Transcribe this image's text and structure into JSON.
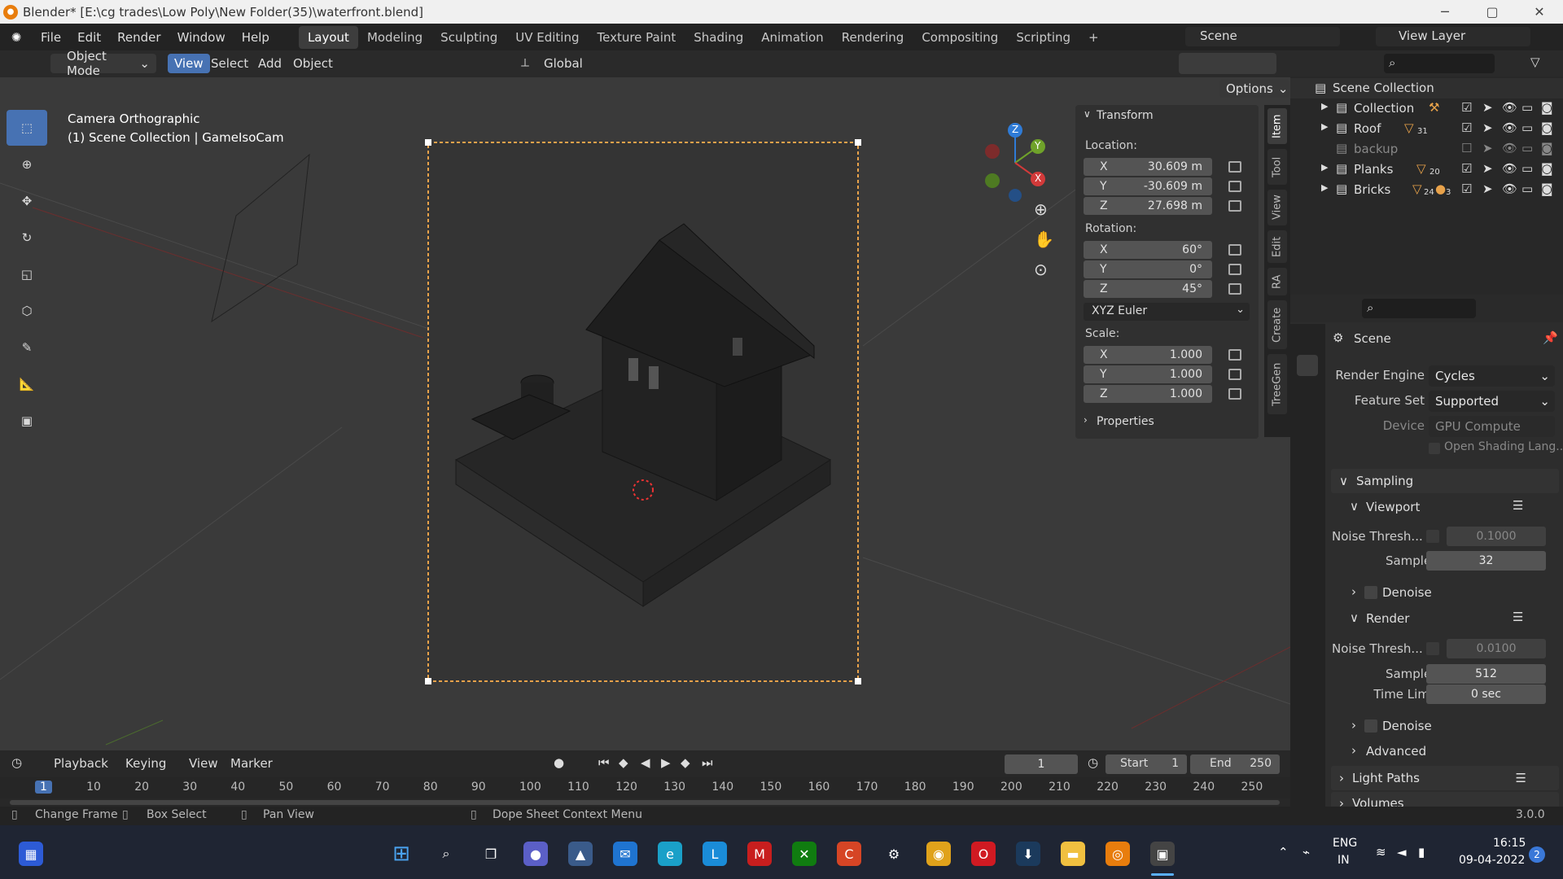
{
  "title_bar": {
    "text": "Blender* [E:\\cg trades\\Low Poly\\New Folder(35)\\waterfront.blend]",
    "min": "─",
    "max": "▢",
    "close": "✕"
  },
  "menu": [
    "File",
    "Edit",
    "Render",
    "Window",
    "Help"
  ],
  "workspaces": [
    "Layout",
    "Modeling",
    "Sculpting",
    "UV Editing",
    "Texture Paint",
    "Shading",
    "Animation",
    "Rendering",
    "Compositing",
    "Scripting",
    "+"
  ],
  "active_workspace": "Layout",
  "scene_field": "Scene",
  "view_layer_field": "View Layer",
  "viewport_header": {
    "mode": "Object Mode",
    "menus": [
      "View",
      "Select",
      "Add",
      "Object"
    ],
    "orientation": "Global",
    "options": "Options"
  },
  "viewport": {
    "info_line1": "Camera Orthographic",
    "info_line2": "(1) Scene Collection | GameIsoCam",
    "gizmo": {
      "x": "X",
      "y": "Y",
      "z": "Z"
    }
  },
  "transform_panel": {
    "title": "Transform",
    "location_label": "Location:",
    "location": [
      {
        "axis": "X",
        "value": "30.609 m"
      },
      {
        "axis": "Y",
        "value": "-30.609 m"
      },
      {
        "axis": "Z",
        "value": "27.698 m"
      }
    ],
    "rotation_label": "Rotation:",
    "rotation": [
      {
        "axis": "X",
        "value": "60°"
      },
      {
        "axis": "Y",
        "value": "0°"
      },
      {
        "axis": "Z",
        "value": "45°"
      }
    ],
    "rotation_mode": "XYZ Euler",
    "scale_label": "Scale:",
    "scale": [
      {
        "axis": "X",
        "value": "1.000"
      },
      {
        "axis": "Y",
        "value": "1.000"
      },
      {
        "axis": "Z",
        "value": "1.000"
      }
    ],
    "properties_label": "Properties"
  },
  "sidebar_tabs": [
    "Item",
    "Tool",
    "View",
    "Edit",
    "RA",
    "Create",
    "TreeGen"
  ],
  "outliner": {
    "root": "Scene Collection",
    "items": [
      {
        "name": "Collection",
        "badge": ""
      },
      {
        "name": "Roof",
        "badge": "31"
      },
      {
        "name": "backup",
        "badge": ""
      },
      {
        "name": "Planks",
        "badge": "20"
      },
      {
        "name": "Bricks",
        "badge": "24",
        "badge2": "3"
      }
    ]
  },
  "properties": {
    "scene_title": "Scene",
    "render_engine_label": "Render Engine",
    "render_engine": "Cycles",
    "feature_set_label": "Feature Set",
    "feature_set": "Supported",
    "device_label": "Device",
    "device": "GPU Compute",
    "osl_label": "Open Shading Lang...",
    "sampling": "Sampling",
    "viewport_sub": "Viewport",
    "noise_thresh_label": "Noise Thresh...",
    "viewport_noise": "0.1000",
    "samples_label": "Samples",
    "viewport_samples": "32",
    "denoise": "Denoise",
    "render_sub": "Render",
    "render_noise": "0.0100",
    "render_samples": "512",
    "time_limit_label": "Time Limit",
    "time_limit": "0 sec",
    "advanced": "Advanced",
    "light_paths": "Light Paths",
    "volumes": "Volumes"
  },
  "timeline": {
    "menus": [
      "Playback",
      "Keying",
      "View",
      "Marker"
    ],
    "current_frame": "1",
    "start_label": "Start",
    "start": "1",
    "end_label": "End",
    "end": "250",
    "ruler": [
      "1",
      "10",
      "20",
      "30",
      "40",
      "50",
      "60",
      "70",
      "80",
      "90",
      "100",
      "110",
      "120",
      "130",
      "140",
      "150",
      "160",
      "170",
      "180",
      "190",
      "200",
      "210",
      "220",
      "230",
      "240",
      "250"
    ]
  },
  "statusbar": {
    "change_frame": "Change Frame",
    "box_select": "Box Select",
    "pan_view": "Pan View",
    "context_menu": "Dope Sheet Context Menu",
    "version": "3.0.0"
  },
  "taskbar": {
    "lang1": "ENG",
    "lang2": "IN",
    "time": "16:15",
    "date": "09-04-2022",
    "notif": "2"
  },
  "colors": {
    "accent": "#4772b3",
    "camera_frame": "#e8a24a",
    "selected": "#e87d0d"
  }
}
